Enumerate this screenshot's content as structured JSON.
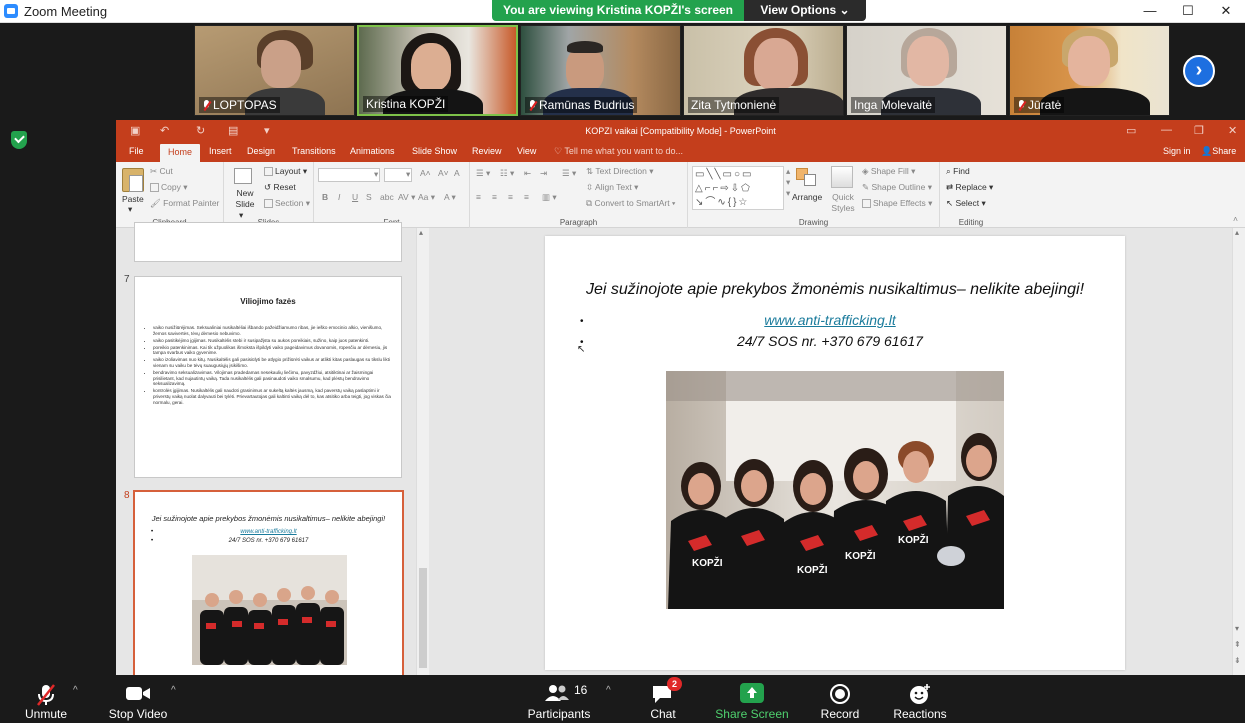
{
  "window": {
    "title": "Zoom Meeting"
  },
  "view_banner": {
    "message": "You are viewing Kristina KOPŽI's screen",
    "options_label": "View Options"
  },
  "participants": [
    {
      "name": "LOPTOPAS",
      "muted": true
    },
    {
      "name": "Kristina KOPŽI",
      "muted": false,
      "active": true
    },
    {
      "name": "Ramūnas Budrius",
      "muted": true
    },
    {
      "name": "Zita Tytmonienė",
      "muted": false
    },
    {
      "name": "Inga Molevaitė",
      "muted": false
    },
    {
      "name": "Jūratė",
      "muted": true
    }
  ],
  "ppt": {
    "doc_title": "KOPZI vaikai [Compatibility Mode] - PowerPoint",
    "tabs": [
      "File",
      "Home",
      "Insert",
      "Design",
      "Transitions",
      "Animations",
      "Slide Show",
      "Review",
      "View"
    ],
    "tell_me": "Tell me what you want to do...",
    "sign_in": "Sign in",
    "share": "Share",
    "ribbon": {
      "clipboard": {
        "paste": "Paste",
        "cut": "Cut",
        "copy": "Copy",
        "format_painter": "Format Painter",
        "label": "Clipboard"
      },
      "slides": {
        "new_slide": "New Slide",
        "layout": "Layout",
        "reset": "Reset",
        "section": "Section",
        "label": "Slides"
      },
      "font": {
        "bold": "B",
        "italic": "I",
        "underline": "U",
        "strike": "S",
        "label": "Font"
      },
      "paragraph": {
        "text_direction": "Text Direction",
        "align_text": "Align Text",
        "convert_smartart": "Convert to SmartArt",
        "label": "Paragraph"
      },
      "drawing": {
        "arrange": "Arrange",
        "quick_styles": "Quick Styles",
        "shape_fill": "Shape Fill",
        "shape_outline": "Shape Outline",
        "shape_effects": "Shape Effects",
        "label": "Drawing"
      },
      "editing": {
        "find": "Find",
        "replace": "Replace",
        "select": "Select",
        "label": "Editing"
      }
    },
    "thumb7": {
      "number": "7",
      "title": "Viliojimo fazės",
      "bullets": [
        "vaiko nusižiūrėjimas. Seksualiniai nusikaltėliai išbando pažeidžiamumo ribas, jie ieško emocinio alkio, vienišumo, žemos savivertės, tėvų dėmesio nebuvimo.",
        "vaiko pasitikėjimo įgijimas. Nusikaltėlis stebi ir susipažįsta su aukos poreikiais, sužino, kaip juos patenkinti.",
        "poreikio patenkinimas. Kai tik užpuolikas išmoksta išpildyti vaiko pageidavimus dovanomis, rūpesčiu ar dėmesiu, jis tampa svarbus vaiko gyvenime.",
        "vaiko izoliavimas nuo kitų. Nusikaltėlis gali pasisiūlyti be atlygio prižiūrėti vaikus ar atlikti kitas paslaugas su tikslu likti vienam su vaiku be tėvų suaugusiųjų įsikišimo.",
        "bendravimo seksualizavimas. Vilojimas pradedamas nesekaulių liečimu, pavyzdžiui, atsitiktinai ar žaismingai prisilietant, kad nujautintų vaiką. Tada nusikaltėlis gali pasinaudoti vaiko smalsumu, kad plėstų bendravimo seksualizavimą.",
        "kontrolės įgijimas. Nusikaltėlis gali naudoti grasinimus ar sukeltą kaltės jausmą, kad paverstų vaiką paslaptimi ir priverstų vaiką nuolat dalyvauti bei tylėti. Prievartautojas gali kaltinti vaiką dėl to, kas atsitiko arba teigti, jog viskas čia normalu, gerai."
      ]
    },
    "thumb8": {
      "number": "8"
    },
    "slide": {
      "heading": "Jei sužinojote apie prekybos žmonėmis nusikaltimus– nelikite abejingi!",
      "link": "www.anti-trafficking.lt",
      "sos": "24/7 SOS nr. +370 679 61617",
      "bullet": "•",
      "photo_shirt_text": "KOPŽI"
    }
  },
  "toolbar": {
    "unmute": "Unmute",
    "stop_video": "Stop Video",
    "participants": "Participants",
    "participants_count": "16",
    "chat": "Chat",
    "chat_badge": "2",
    "share_screen": "Share Screen",
    "record": "Record",
    "reactions": "Reactions"
  },
  "colors": {
    "zoom_green": "#23a24d",
    "ppt_red": "#c43e1c",
    "zoom_blue": "#2d8cff"
  }
}
